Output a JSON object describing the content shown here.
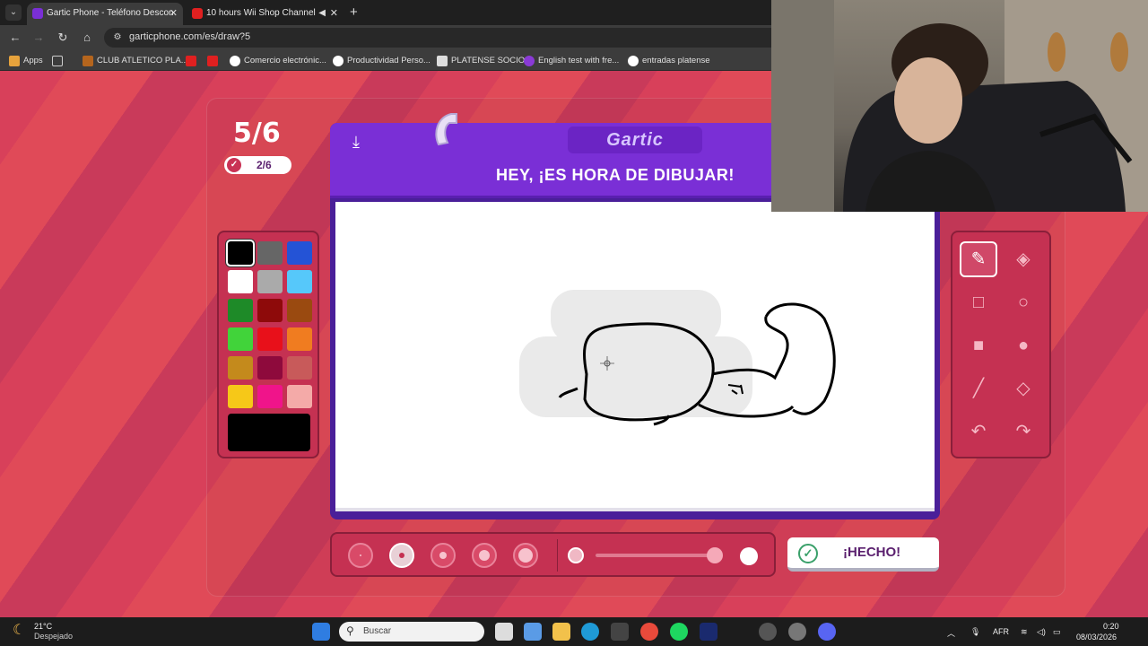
{
  "browser": {
    "tabs": [
      {
        "title": "Gartic Phone - Teléfono Descon",
        "active": true
      },
      {
        "title": "10 hours Wii Shop Channel",
        "active": false
      }
    ],
    "url": "garticphone.com/es/draw?5",
    "bookmarks": [
      "Apps",
      "CLUB ATLETICO PLA...",
      "Comercio electrónic...",
      "Productividad Perso...",
      "PLATENSE SOCIO",
      "English test with fre...",
      "entradas platense"
    ]
  },
  "game": {
    "round": "5/6",
    "players_done": "2/6",
    "logo": "Gartic",
    "instruction": "HEY, ¡ES HORA DE DIBUJAR!",
    "done_button": "¡HECHO!",
    "palette": {
      "colors": [
        "#000000",
        "#666666",
        "#2453d6",
        "#ffffff",
        "#aaaaaa",
        "#56c8fa",
        "#1e8a28",
        "#8e0a0a",
        "#9a4a10",
        "#41d33a",
        "#e8101a",
        "#f07c20",
        "#c48a1c",
        "#8e0a3c",
        "#c85a5a",
        "#f6c818",
        "#f0148a",
        "#f4aaa8"
      ],
      "selected": "#000000"
    },
    "brush_sizes": [
      "1",
      "2",
      "3",
      "4",
      "5"
    ],
    "selected_brush": "2",
    "opacity": 0.95,
    "tools": [
      "pencil",
      "eraser",
      "rectangle-outline",
      "circle-outline",
      "rectangle-filled",
      "circle-filled",
      "line",
      "fill-bucket",
      "undo",
      "redo"
    ],
    "selected_tool": "pencil"
  },
  "taskbar": {
    "temperature": "21°C",
    "condition": "Despejado",
    "search_placeholder": "Buscar",
    "keyboard": "AFR",
    "time": "0:20",
    "date": "08/03/2026"
  }
}
